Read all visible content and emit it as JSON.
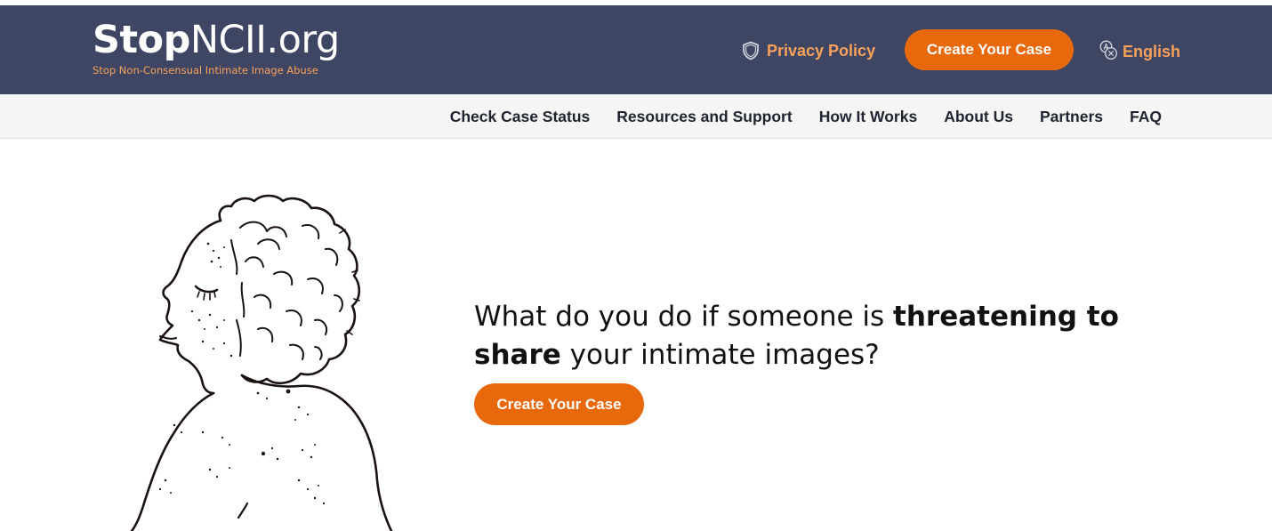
{
  "header": {
    "logo_bold": "Stop",
    "logo_light": "NCII.org",
    "tagline": "Stop Non-Consensual Intimate Image Abuse",
    "privacy_label": "Privacy Policy",
    "cta_label": "Create Your Case",
    "language_label": "English",
    "privacy_icon": "shield-icon",
    "language_icon": "translate-icon"
  },
  "nav": {
    "items": [
      {
        "label": "Check Case Status"
      },
      {
        "label": "Resources and Support"
      },
      {
        "label": "How It Works"
      },
      {
        "label": "About Us"
      },
      {
        "label": "Partners"
      },
      {
        "label": "FAQ"
      }
    ]
  },
  "hero": {
    "heading_part1": "What do you do if someone is ",
    "heading_bold": "threatening to share",
    "heading_part2": " your intimate images?",
    "cta_label": "Create Your Case"
  },
  "colors": {
    "header_bg": "#3f4664",
    "accent_orange": "#e8680c",
    "link_orange": "#f7a15a",
    "subnav_bg": "#f4f5f4"
  }
}
